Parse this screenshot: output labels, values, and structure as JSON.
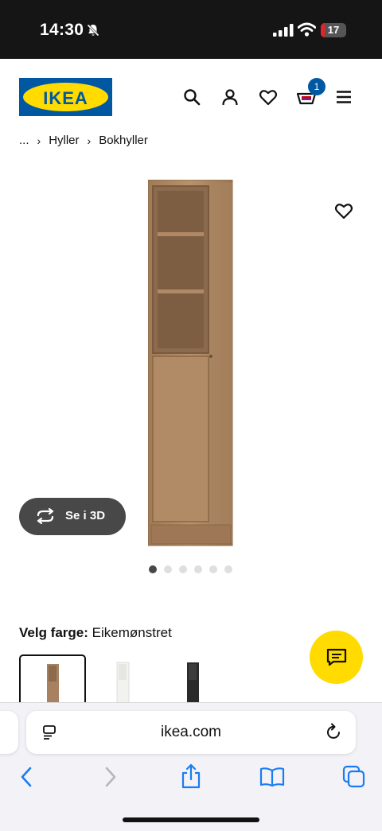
{
  "status_bar": {
    "time": "14:30",
    "battery": "17",
    "battery_level": 0.17
  },
  "brand": {
    "logo_text": "IKEA",
    "blue": "#0058a3",
    "yellow": "#ffdb00"
  },
  "header": {
    "icons": [
      "search-icon",
      "account-icon",
      "heart-icon",
      "cart-icon",
      "menu-icon"
    ],
    "cart_count": "1"
  },
  "breadcrumb": {
    "ellipsis": "...",
    "items": [
      "Hyller",
      "Bokhyller"
    ]
  },
  "gallery": {
    "button_3d_label": "Se i 3D",
    "image_count": 6,
    "active_index": 0
  },
  "color_selector": {
    "label": "Velg farge:",
    "value": "Eikemønstret",
    "swatches": [
      "Eikemønstret",
      "Hvit",
      "Svart"
    ],
    "selected_index": 0
  },
  "browser": {
    "url": "ikea.com",
    "icons": [
      "back-icon",
      "forward-icon",
      "share-icon",
      "bookmarks-icon",
      "tabs-icon"
    ]
  }
}
